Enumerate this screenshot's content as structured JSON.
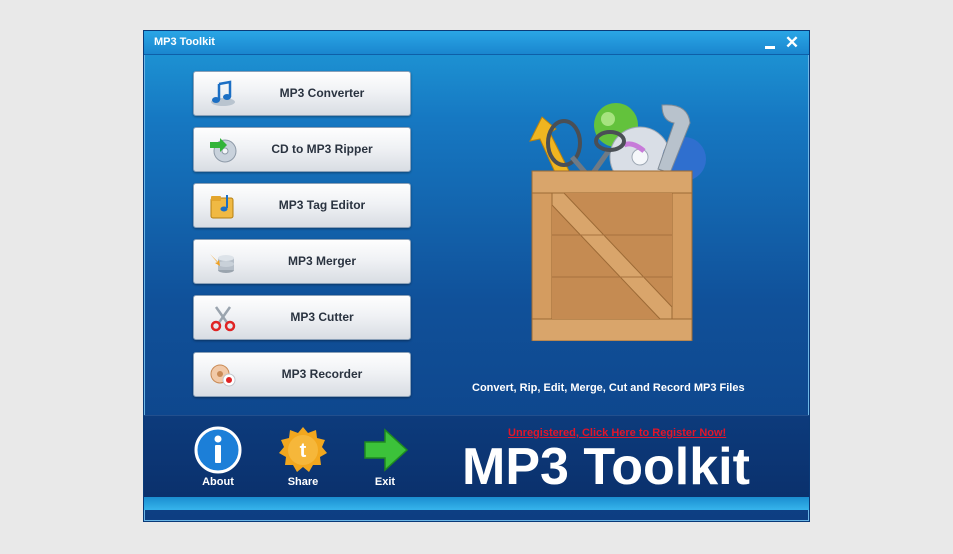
{
  "window": {
    "title": "MP3 Toolkit",
    "minimize_symbol": "",
    "close_symbol": "✕"
  },
  "menu": {
    "items": [
      {
        "label": "MP3 Converter",
        "icon": "music-note-icon"
      },
      {
        "label": "CD to MP3 Ripper",
        "icon": "cd-rip-icon"
      },
      {
        "label": "MP3 Tag Editor",
        "icon": "tag-folder-icon"
      },
      {
        "label": "MP3 Merger",
        "icon": "merge-icon"
      },
      {
        "label": "MP3 Cutter",
        "icon": "scissors-icon"
      },
      {
        "label": "MP3 Recorder",
        "icon": "recorder-icon"
      }
    ]
  },
  "main": {
    "tagline": "Convert, Rip, Edit, Merge, Cut and Record MP3 Files",
    "illustration": "toolbox-crate-icon"
  },
  "footer": {
    "about_label": "About",
    "share_label": "Share",
    "exit_label": "Exit",
    "register_link": "Unregistered, Click Here to Register Now!",
    "product_name": "MP3 Toolkit"
  },
  "colors": {
    "window_top": "#1f9ad8",
    "window_bottom": "#0d3e82",
    "footer_bar": "#0a2f6a",
    "register_link": "#e0162b",
    "exit_arrow": "#3cc23a",
    "share_badge": "#f2a71e",
    "about_badge": "#1c7fd8"
  }
}
